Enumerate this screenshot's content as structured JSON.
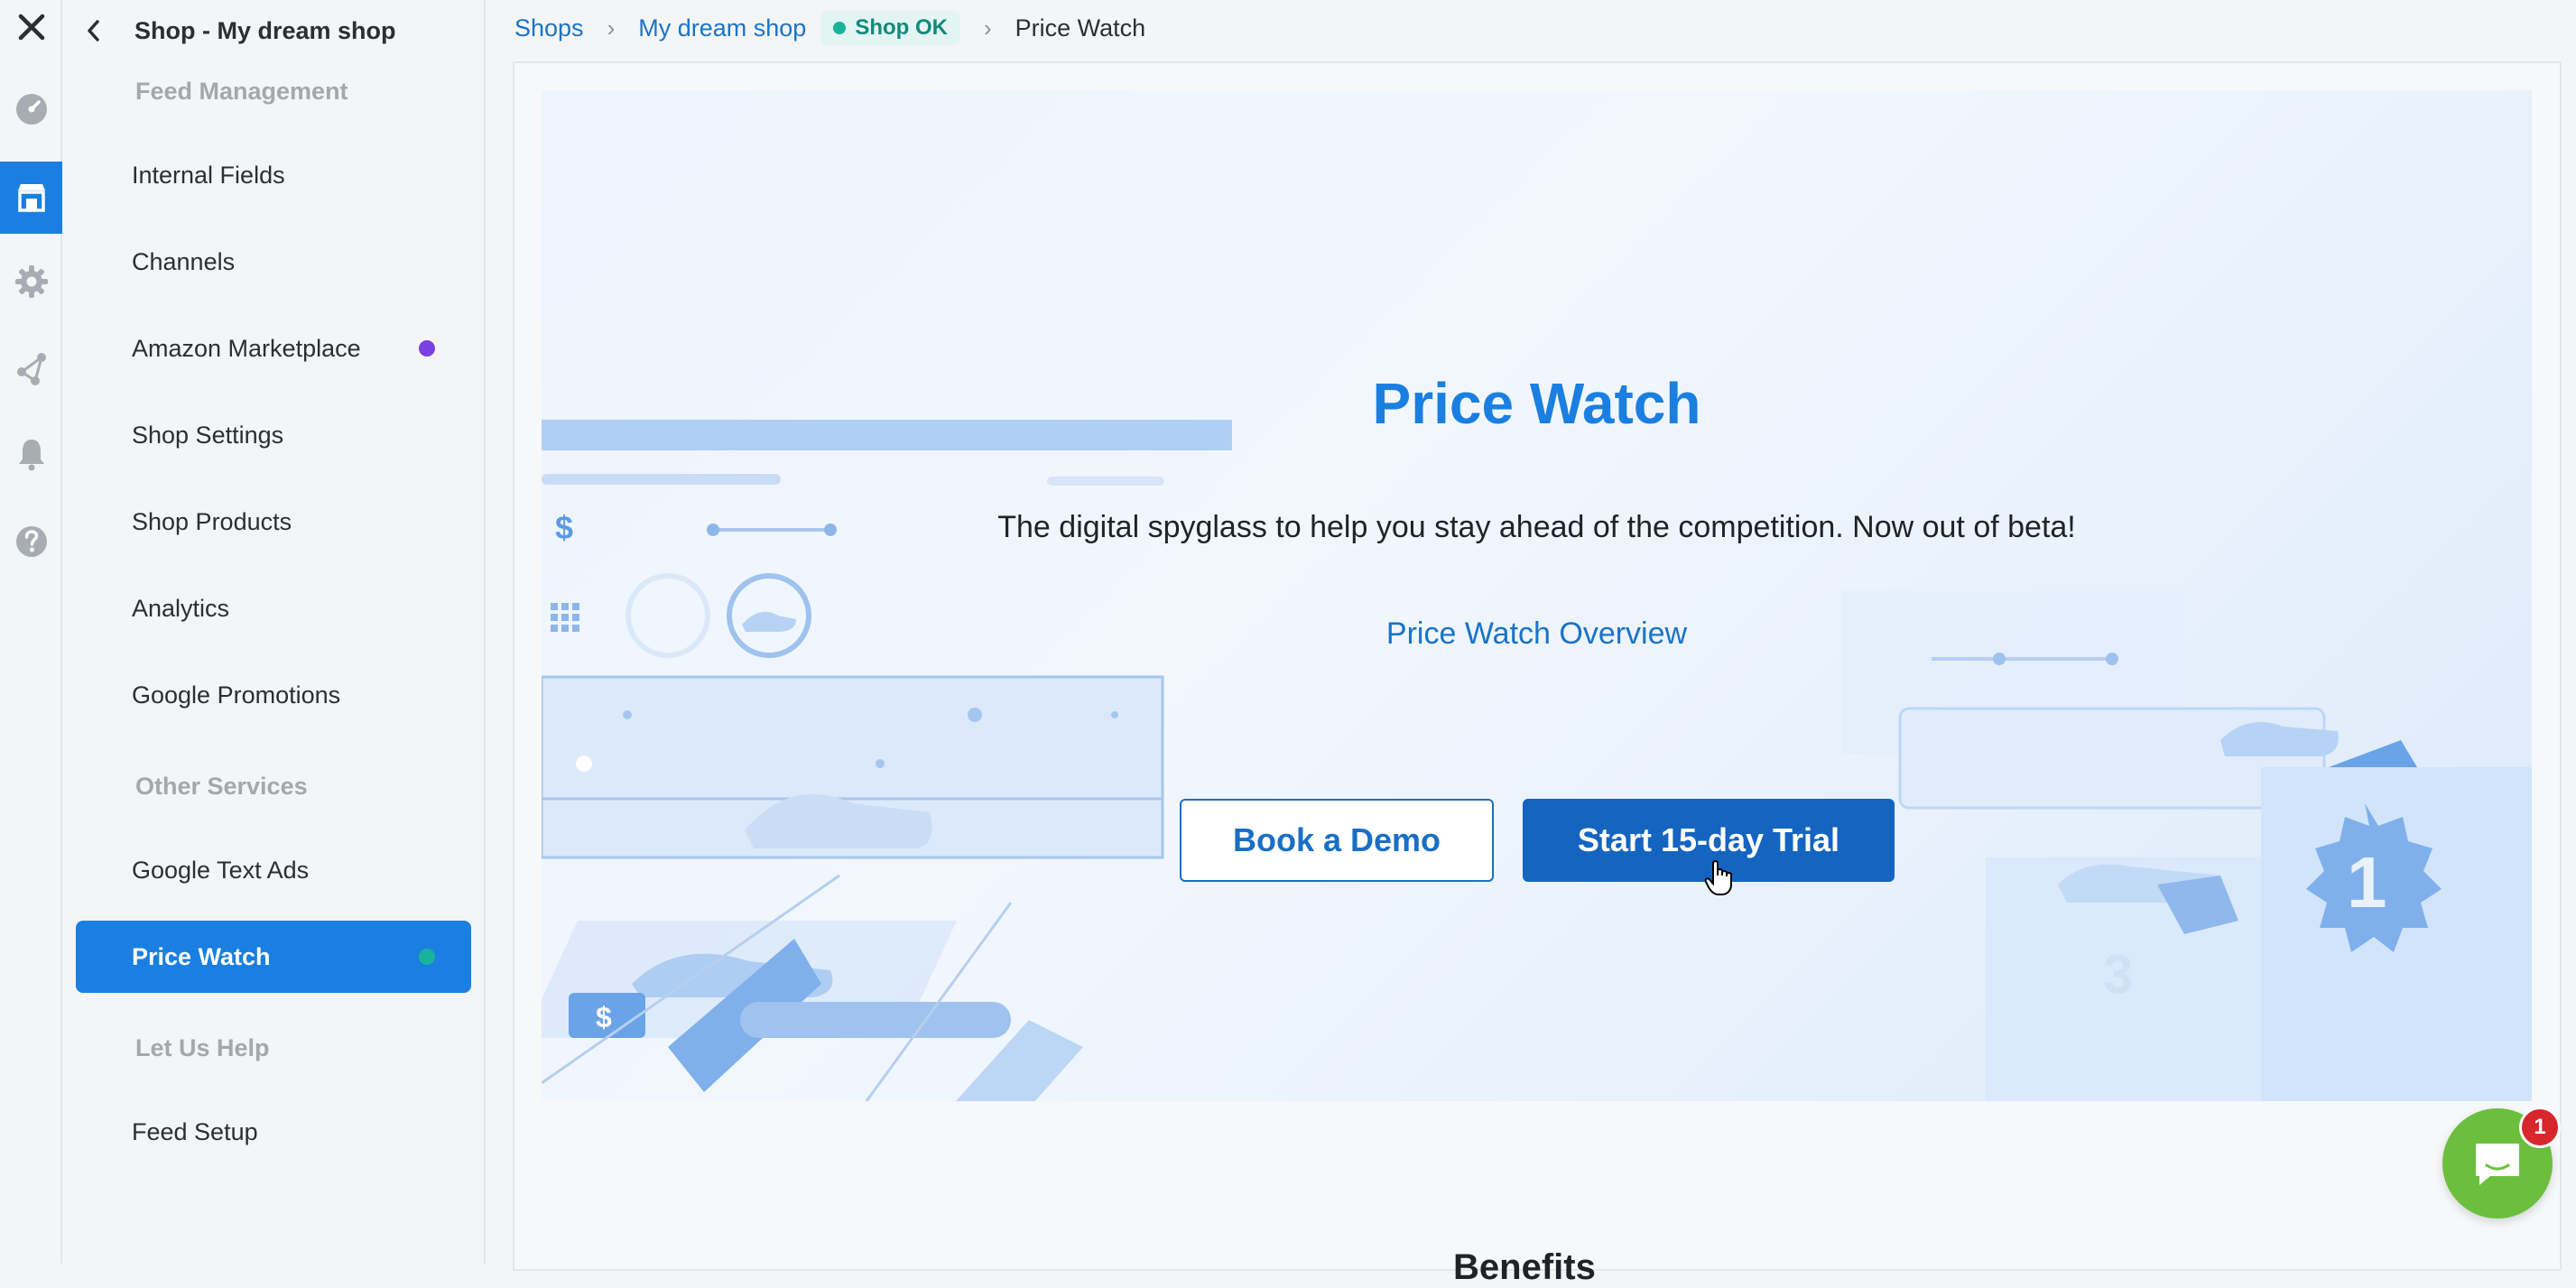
{
  "rail": {
    "close_icon": "close-icon",
    "items": [
      {
        "icon": "dashboard-icon",
        "active": false
      },
      {
        "icon": "shop-icon",
        "active": true
      },
      {
        "icon": "gear-icon",
        "active": false
      },
      {
        "icon": "share-icon",
        "active": false
      },
      {
        "icon": "bell-icon",
        "active": false
      },
      {
        "icon": "help-icon",
        "active": false
      }
    ]
  },
  "sidebar": {
    "title": "Shop - My dream shop",
    "section_feed": "Feed Management",
    "section_other": "Other Services",
    "section_help": "Let Us Help",
    "items": [
      {
        "label": "Internal Fields"
      },
      {
        "label": "Channels"
      },
      {
        "label": "Amazon Marketplace",
        "dot_color": "#7b3fe4"
      },
      {
        "label": "Shop Settings"
      },
      {
        "label": "Shop Products"
      },
      {
        "label": "Analytics"
      },
      {
        "label": "Google Promotions"
      },
      {
        "label": "Google Text Ads"
      },
      {
        "label": "Price Watch",
        "active": true,
        "dot_color": "#19b39c"
      },
      {
        "label": "Feed Setup"
      }
    ]
  },
  "breadcrumb": {
    "shops": "Shops",
    "shop": "My dream shop",
    "status": "Shop OK",
    "current": "Price Watch"
  },
  "hero": {
    "title": "Price Watch",
    "subtitle": "The digital spyglass to help you stay ahead of the competition. Now out of beta!",
    "overview_link": "Price Watch Overview",
    "demo_button": "Book a Demo",
    "trial_button": "Start 15-day Trial"
  },
  "below": {
    "heading_partial": "Benefits"
  },
  "chat": {
    "badge_count": "1"
  },
  "colors": {
    "accent": "#1a7fe0",
    "button_primary": "#1464c0",
    "status_ok": "#19b39c",
    "amazon_dot": "#7b3fe4",
    "chat_green": "#6bbf3d",
    "chat_badge": "#d7262c"
  }
}
